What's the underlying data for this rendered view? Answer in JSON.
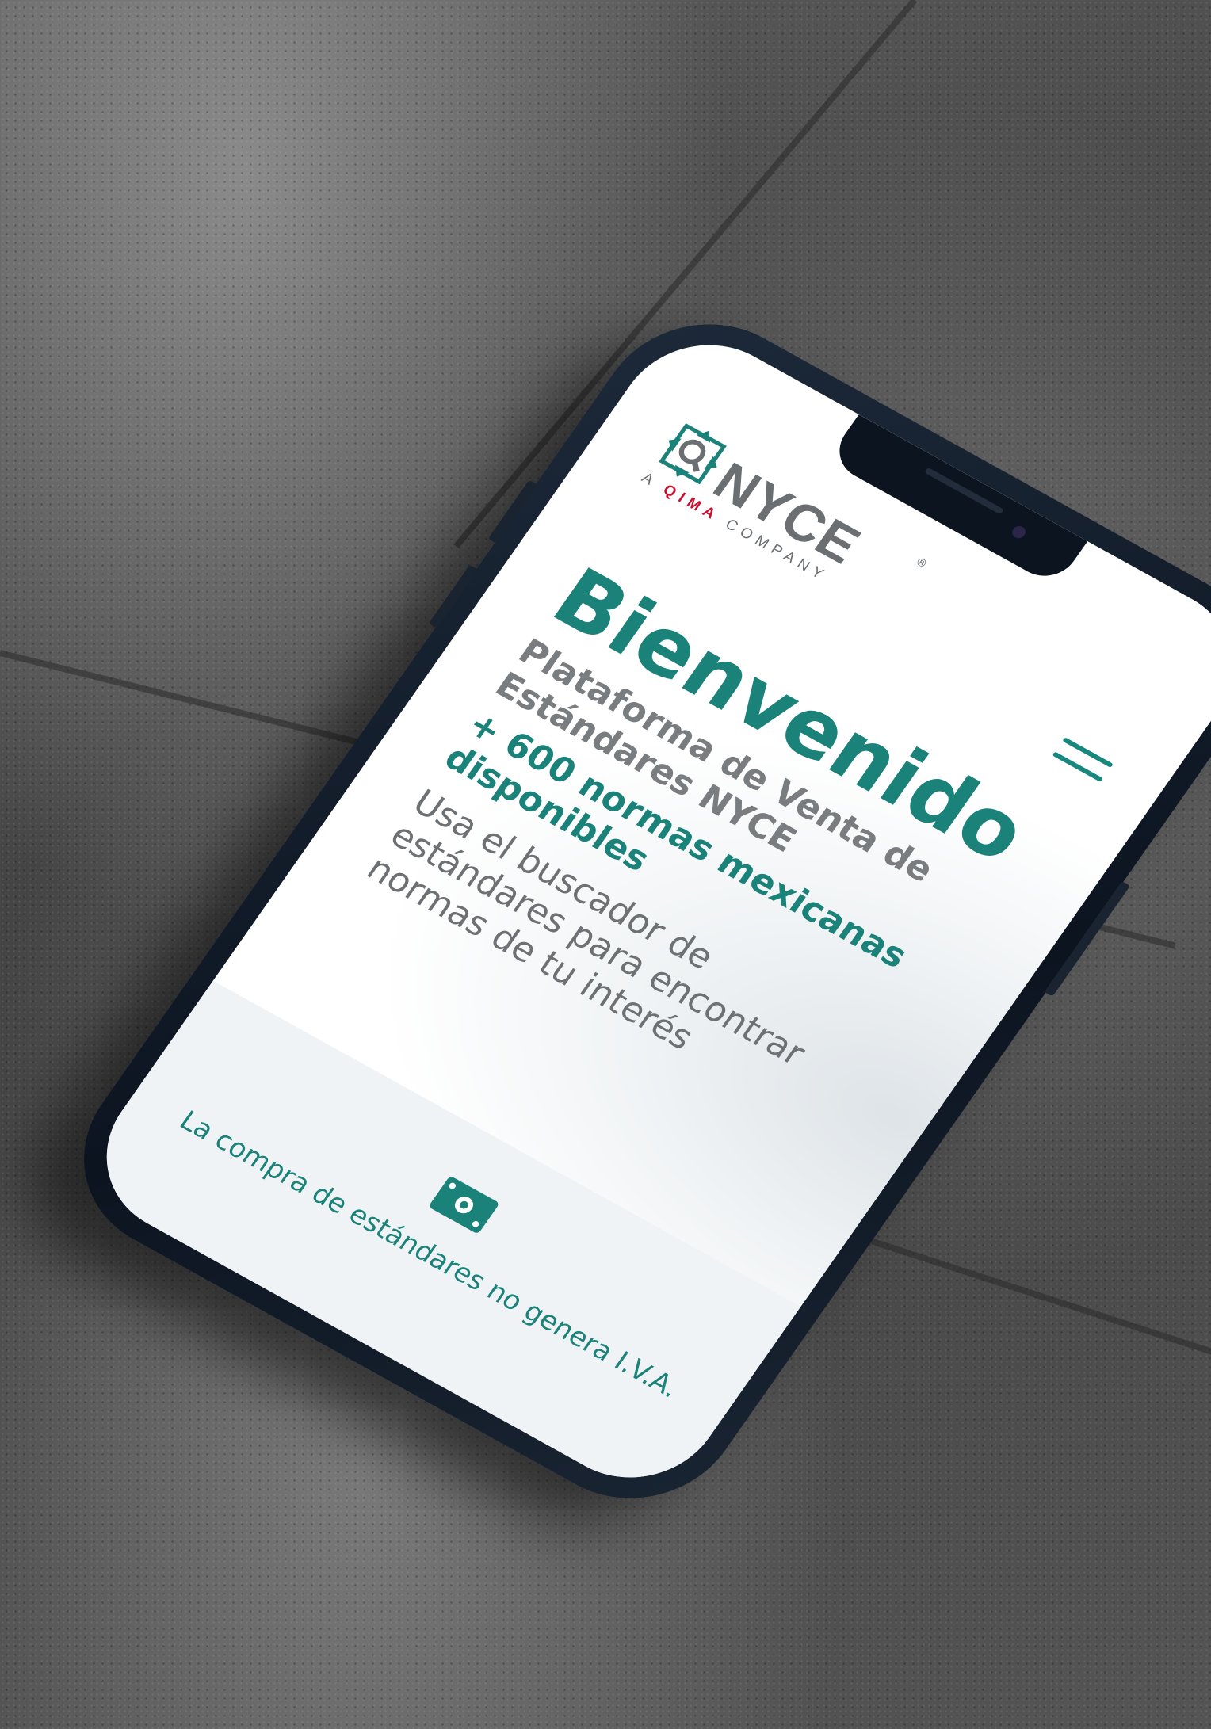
{
  "brand": {
    "name": "NYCE",
    "tagline_prefix": "A",
    "tagline_highlight": "QIMA",
    "tagline_suffix": "COMPANY",
    "registered": "®",
    "primary_color": "#1a8278",
    "accent_color": "#c8102e",
    "gray_color": "#6b6f72"
  },
  "header": {
    "menu_icon": "hamburger-menu-icon"
  },
  "hero": {
    "title": "Bienvenido",
    "subtitle": "Plataforma de Venta de Estándares NYCE",
    "highlight": "+ 600 normas mexicanas disponibles",
    "description": "Usa el buscador de estándares para encontrar normas de tu interés"
  },
  "footer": {
    "icon": "money-bill-icon",
    "notice": "La compra de estándares no genera I.V.A."
  }
}
